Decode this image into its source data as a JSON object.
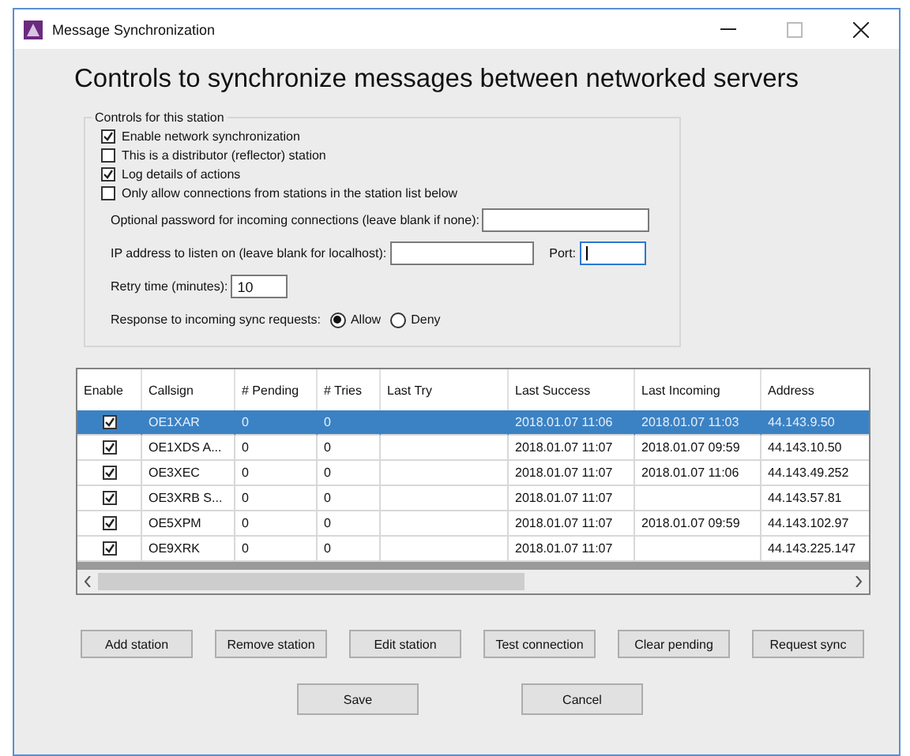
{
  "window": {
    "title": "Message Synchronization"
  },
  "heading": "Controls to synchronize messages between networked servers",
  "station_group": {
    "title": "Controls for this station",
    "options": [
      {
        "label": "Enable network synchronization",
        "checked": true
      },
      {
        "label": "This is a distributor (reflector) station",
        "checked": false
      },
      {
        "label": "Log details of actions",
        "checked": true
      },
      {
        "label": "Only allow connections from stations in the station list below",
        "checked": false
      }
    ],
    "password": {
      "label": "Optional password for incoming connections (leave blank if none):"
    },
    "ip_address": {
      "label": "IP address to listen on (leave blank for localhost):"
    },
    "port": {
      "label": "Port:",
      "focused": true
    },
    "retry": {
      "label": "Retry time (minutes):",
      "value": "10"
    },
    "response": {
      "label": "Response to incoming sync requests:",
      "options": [
        {
          "label": "Allow",
          "selected": true
        },
        {
          "label": "Deny",
          "selected": false
        }
      ]
    }
  },
  "table": {
    "enable_column": "Enable",
    "columns": [
      "Callsign",
      "# Pending",
      "# Tries",
      "Last Try",
      "Last Success",
      "Last Incoming",
      "Address"
    ],
    "rows": [
      {
        "selected": true,
        "enabled": true,
        "cells": [
          "OE1XAR",
          "0",
          "0",
          "",
          "2018.01.07 11:06",
          "2018.01.07 11:03",
          "44.143.9.50"
        ]
      },
      {
        "selected": false,
        "enabled": true,
        "cells": [
          "OE1XDS A...",
          "0",
          "0",
          "",
          "2018.01.07 11:07",
          "2018.01.07 09:59",
          "44.143.10.50"
        ]
      },
      {
        "selected": false,
        "enabled": true,
        "cells": [
          "OE3XEC",
          "0",
          "0",
          "",
          "2018.01.07 11:07",
          "2018.01.07 11:06",
          "44.143.49.252"
        ]
      },
      {
        "selected": false,
        "enabled": true,
        "cells": [
          "OE3XRB S...",
          "0",
          "0",
          "",
          "2018.01.07 11:07",
          "",
          "44.143.57.81"
        ]
      },
      {
        "selected": false,
        "enabled": true,
        "cells": [
          "OE5XPM",
          "0",
          "0",
          "",
          "2018.01.07 11:07",
          "2018.01.07 09:59",
          "44.143.102.97"
        ]
      },
      {
        "selected": false,
        "enabled": true,
        "cells": [
          "OE9XRK",
          "0",
          "0",
          "",
          "2018.01.07 11:07",
          "",
          "44.143.225.147"
        ]
      }
    ]
  },
  "action_buttons": [
    "Add station",
    "Remove station",
    "Edit station",
    "Test connection",
    "Clear pending",
    "Request sync"
  ],
  "dialog_buttons": [
    "Save",
    "Cancel"
  ]
}
